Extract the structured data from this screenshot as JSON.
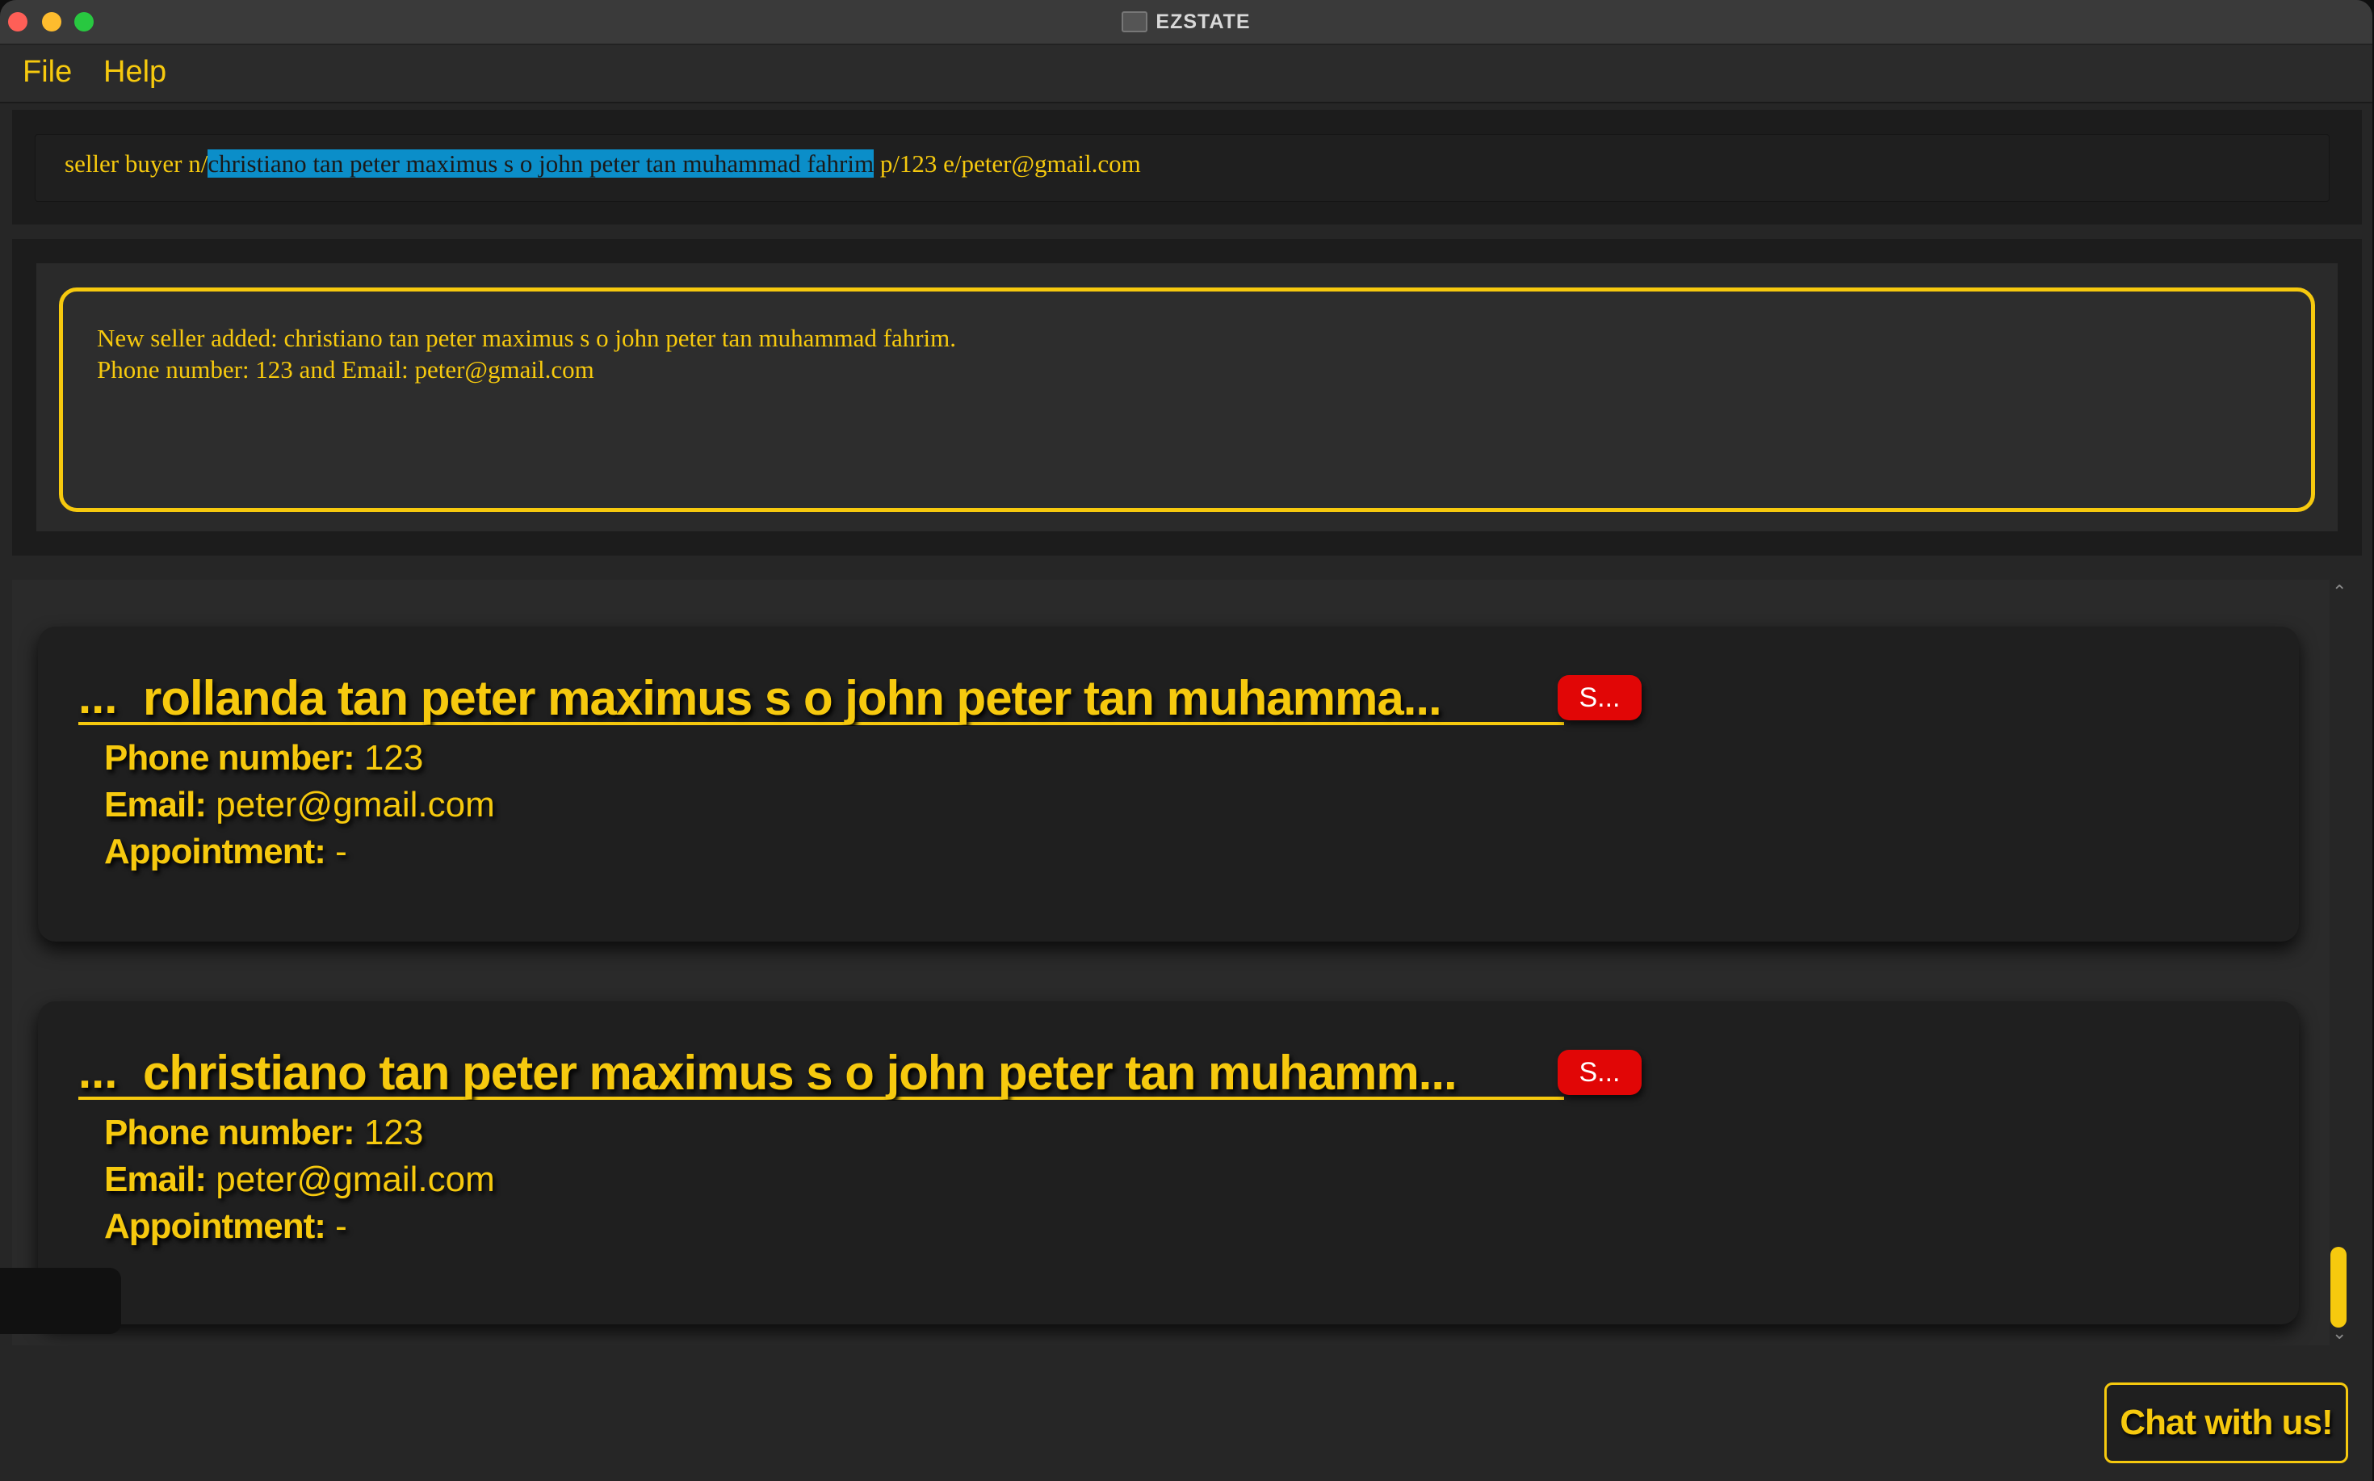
{
  "window": {
    "title": "EZSTATE"
  },
  "menu": {
    "file": "File",
    "help": "Help"
  },
  "command": {
    "prefix": "seller buyer n/",
    "selected": "christiano tan peter maximus s o john peter tan muhammad fahrim",
    "suffix": " p/123 e/peter@gmail.com"
  },
  "result": {
    "line1": "New seller added: christiano tan peter maximus s o john peter tan muhammad fahrim.",
    "line2": "Phone number: 123 and Email: peter@gmail.com"
  },
  "cards": [
    {
      "ellipsis": "...",
      "name": "rollanda tan peter maximus s o john peter tan muhamma...",
      "tag": "S...",
      "phone_label": "Phone number:",
      "phone": " 123",
      "email_label": "Email:",
      "email": " peter@gmail.com",
      "appt_label": "Appointment:",
      "appt": " -"
    },
    {
      "ellipsis": "...",
      "name": "christiano tan peter maximus s o john peter tan muhamm...",
      "tag": "S...",
      "phone_label": "Phone number:",
      "phone": " 123",
      "email_label": "Email:",
      "email": " peter@gmail.com",
      "appt_label": "Appointment:",
      "appt": " -"
    }
  ],
  "chat": {
    "label": "Chat with us!"
  },
  "icons": {
    "close": "close-dot",
    "minimize": "minimize-dot",
    "maximize": "maximize-dot",
    "app": "app-icon",
    "scroll_up": "chevron-up-icon",
    "scroll_down": "chevron-down-icon"
  },
  "colors": {
    "accent": "#f6c90e",
    "tag": "#e10606",
    "selection": "#0b8ec9",
    "background": "#262626"
  }
}
